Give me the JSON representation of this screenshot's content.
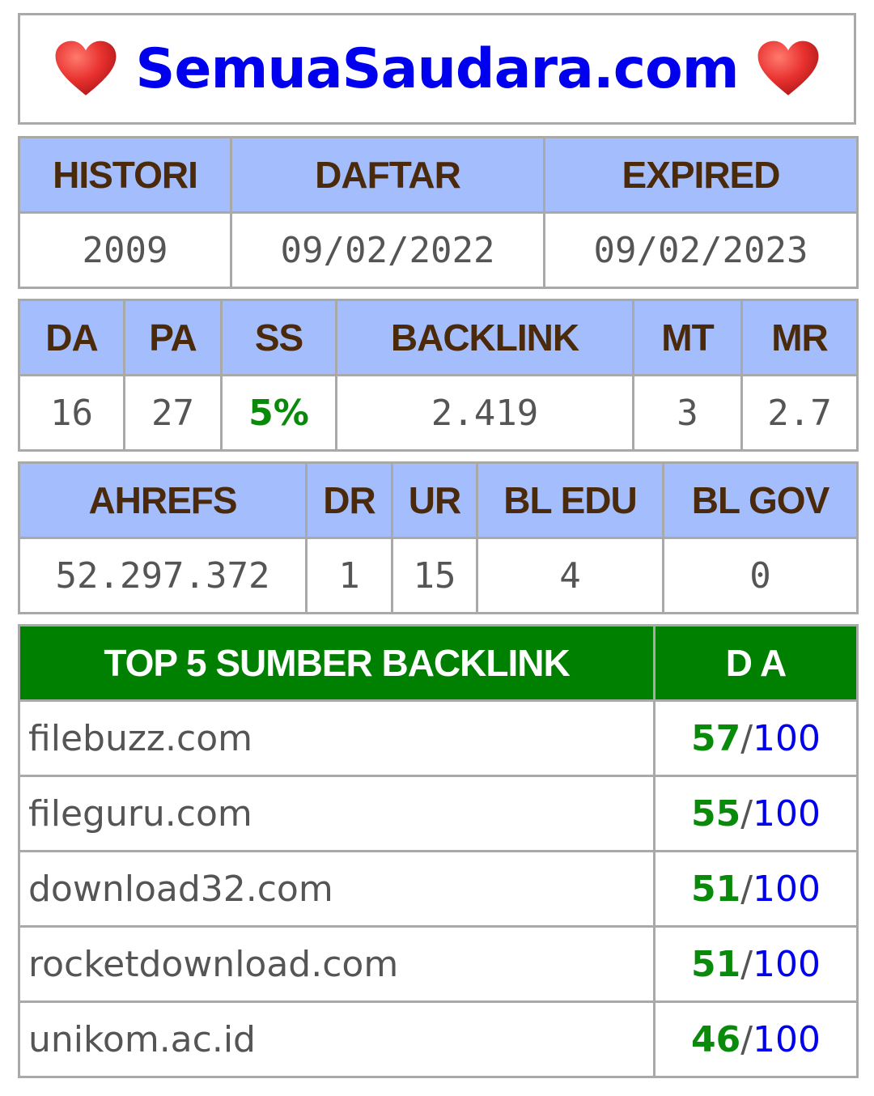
{
  "site": {
    "title": "SemuaSaudara.com"
  },
  "table1": {
    "headers": [
      "HISTORI",
      "DAFTAR",
      "EXPIRED"
    ],
    "values": [
      "2009",
      "09/02/2022",
      "09/02/2023"
    ]
  },
  "table2": {
    "headers": [
      "DA",
      "PA",
      "SS",
      "BACKLINK",
      "MT",
      "MR"
    ],
    "values": [
      "16",
      "27",
      "5%",
      "2.419",
      "3",
      "2.7"
    ]
  },
  "table3": {
    "headers": [
      "AHREFS",
      "DR",
      "UR",
      "BL EDU",
      "BL GOV"
    ],
    "values": [
      "52.297.372",
      "1",
      "15",
      "4",
      "0"
    ]
  },
  "top5": {
    "header_source": "TOP 5 SUMBER BACKLINK",
    "header_da": "D A",
    "rows": [
      {
        "site": "filebuzz.com",
        "da": "57",
        "max": "100"
      },
      {
        "site": "fileguru.com",
        "da": "55",
        "max": "100"
      },
      {
        "site": "download32.com",
        "da": "51",
        "max": "100"
      },
      {
        "site": "rocketdownload.com",
        "da": "51",
        "max": "100"
      },
      {
        "site": "unikom.ac.id",
        "da": "46",
        "max": "100"
      }
    ],
    "separator": "/"
  },
  "colors": {
    "header_blue": "#a4bdfc",
    "header_green": "#008000",
    "title_blue": "#0000ee",
    "heart_red": "#e8312f"
  },
  "icons": {
    "left": "heart-icon",
    "right": "heart-icon"
  }
}
